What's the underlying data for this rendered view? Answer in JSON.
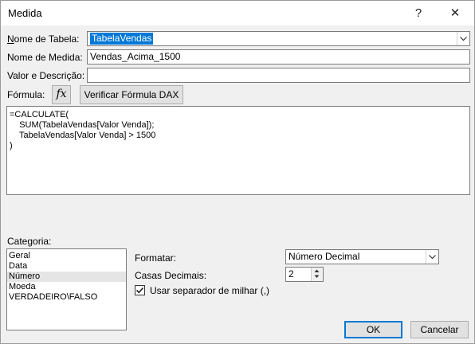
{
  "window": {
    "title": "Medida",
    "help_glyph": "?",
    "close_glyph": "✕"
  },
  "form": {
    "table_name_label": "Nome de Tabela:",
    "table_name_value": "TabelaVendas",
    "measure_name_label": "Nome de Medida:",
    "measure_name_value": "Vendas_Acima_1500",
    "description_label": "Valor e Descrição:",
    "description_value": "",
    "formula_label": "Fórmula:",
    "fx_label": "fx",
    "check_dax_label": "Verificar Fórmula DAX",
    "formula_lines": [
      "=CALCULATE(",
      "    SUM(TabelaVendas[Valor Venda]);",
      "    TabelaVendas[Valor Venda] > 1500",
      ")"
    ]
  },
  "category": {
    "label": "Categoria:",
    "items": [
      "Geral",
      "Data",
      "Número",
      "Moeda",
      "VERDADEIRO\\FALSO"
    ],
    "selected": "Número"
  },
  "format": {
    "format_label": "Formatar:",
    "format_value": "Número Decimal",
    "decimals_label": "Casas Decimais:",
    "decimals_value": "2",
    "separator_label": "Usar separador de milhar (,)",
    "separator_checked": true
  },
  "buttons": {
    "ok": "OK",
    "cancel": "Cancelar"
  },
  "icons": {
    "help": "help-icon",
    "close": "close-icon",
    "combo_arrow": "chevron-down-icon",
    "fx": "function-icon",
    "checkmark": "checkmark-icon"
  },
  "colors": {
    "selection": "#0078d7",
    "dialog_bg": "#f0f0f0",
    "default_button_border": "#0078d7"
  }
}
